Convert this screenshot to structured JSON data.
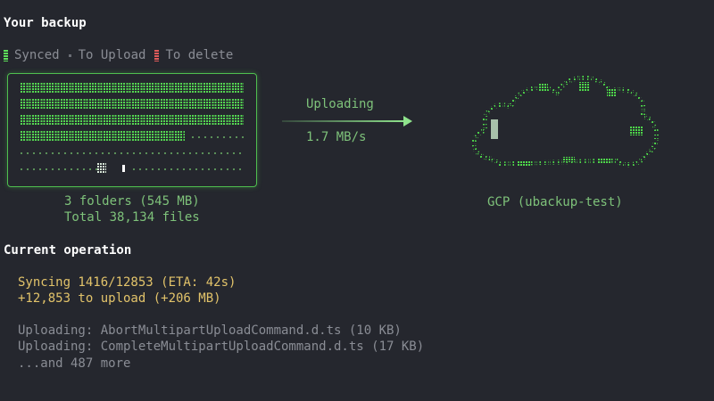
{
  "backup": {
    "title": "Your backup",
    "legend": {
      "synced": "Synced",
      "to_upload": "To Upload",
      "to_delete": "To delete"
    },
    "folders": "3 folders (545 MB)",
    "total": "Total 38,134 files"
  },
  "transfer": {
    "status": "Uploading",
    "speed": "1.7 MB/s"
  },
  "destination": {
    "label": "GCP (ubackup-test)"
  },
  "operation": {
    "title": "Current operation",
    "progress": "Syncing 1416/12853 (ETA: 42s)",
    "summary": "+12,853 to upload (+206 MB)",
    "files": [
      "Uploading: AbortMultipartUploadCommand.d.ts (10 KB)",
      "Uploading: CompleteMultipartUploadCommand.d.ts (17 KB)"
    ],
    "more": "...and 487 more"
  },
  "colors": {
    "background": "#25272e",
    "synced": "#55d852",
    "to_delete": "#e05a5a",
    "accent_text": "#7ec27a",
    "warning_text": "#e2c36a"
  },
  "icons": [
    "cloud-icon",
    "arrow-right-icon"
  ]
}
